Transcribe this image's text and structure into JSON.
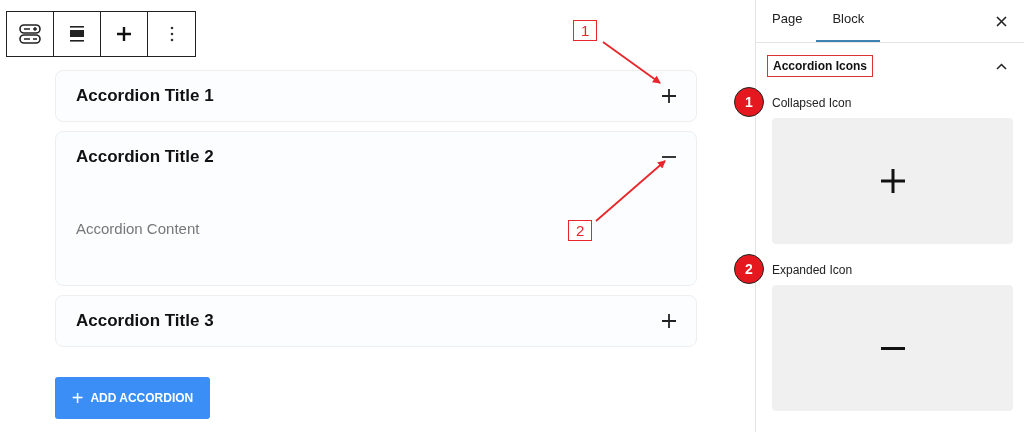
{
  "toolbar": [
    {
      "kind": "accordion"
    },
    {
      "kind": "align"
    },
    {
      "kind": "add"
    },
    {
      "kind": "more"
    }
  ],
  "accordion": [
    {
      "title": "Accordion Title 1",
      "expanded": false
    },
    {
      "title": "Accordion Title 2",
      "expanded": true,
      "content": "Accordion Content"
    },
    {
      "title": "Accordion Title 3",
      "expanded": false
    }
  ],
  "add_button": {
    "icon": "+",
    "label": "ADD ACCORDION"
  },
  "sidebar": {
    "tabs": [
      {
        "label": "Page",
        "selected": false
      },
      {
        "label": "Block",
        "selected": true
      }
    ],
    "section": {
      "title": "Accordion Icons",
      "expanded": true
    },
    "fields": [
      {
        "badge": "1",
        "label": "Collapsed Icon",
        "kind": "plus"
      },
      {
        "badge": "2",
        "label": "Expanded Icon",
        "kind": "minus"
      }
    ]
  },
  "callouts": [
    "1",
    "2"
  ]
}
